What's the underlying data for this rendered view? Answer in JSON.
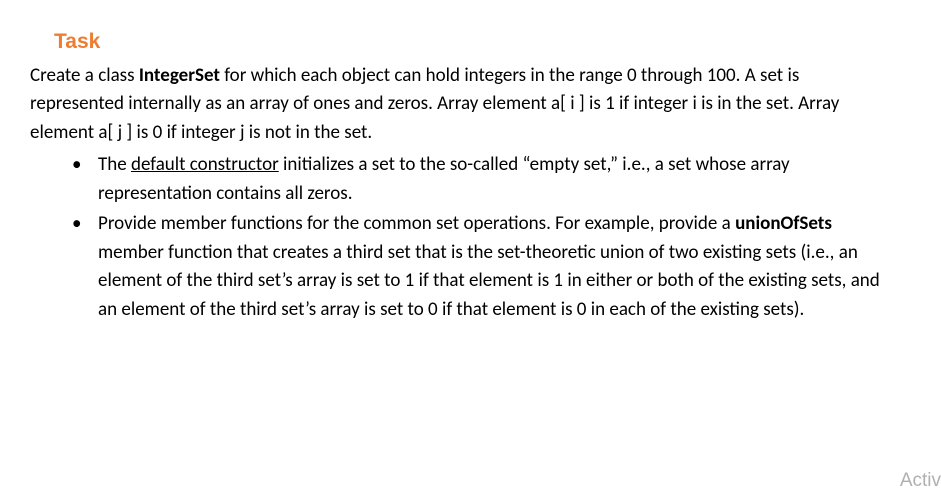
{
  "heading": "Task",
  "intro": {
    "prefix": "Create a class ",
    "className": "IntegerSet",
    "suffix": " for which each object can hold integers in the range 0 through 100. A set is represented internally as an array of ones and zeros. Array element a[ i ] is 1 if integer i is in the set. Array element a[ j ] is 0 if integer j is not in the set."
  },
  "bullets": [
    {
      "prefix": "The ",
      "underlined": "default constructor",
      "suffix": " initializes a set to the so-called “empty set,” i.e., a set whose array representation contains all zeros."
    },
    {
      "prefix": "Provide member functions for the common set operations. For example, provide a ",
      "bold": "unionOfSets",
      "suffix": " member function that creates a third set that is the set-theoretic union of two existing sets (i.e., an element of the third set’s array is set to 1 if that element is 1 in either or both of the existing sets, and an element of the third set’s array is set to 0 if that element is 0 in each of the existing sets)."
    }
  ],
  "watermark": "Activ"
}
